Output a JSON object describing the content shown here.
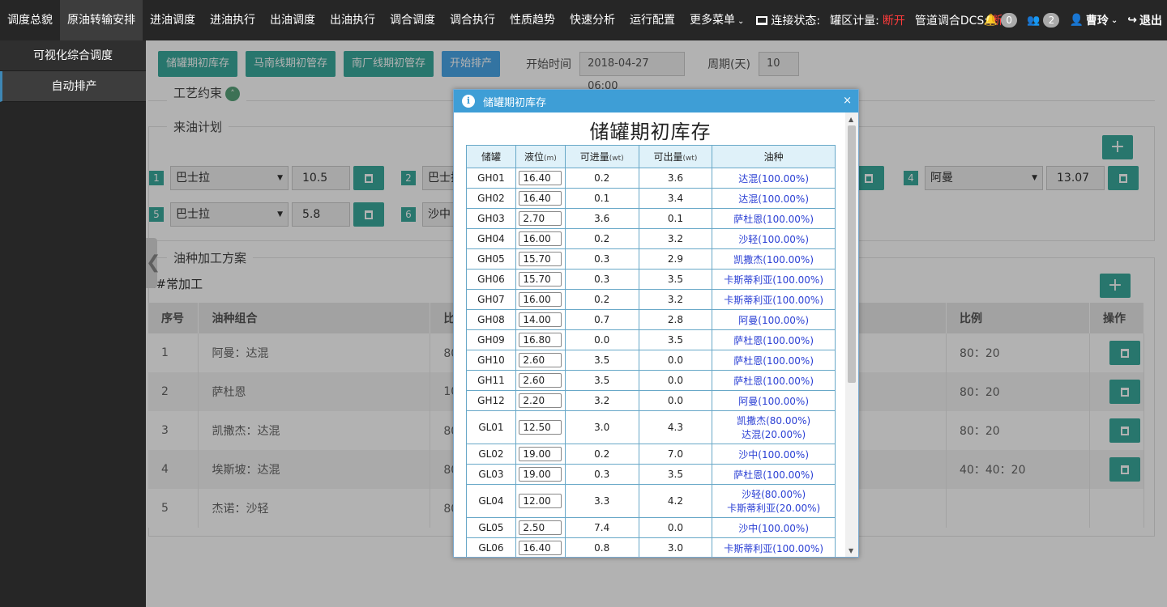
{
  "nav": {
    "items": [
      "调度总貌",
      "原油转输安排",
      "进油调度",
      "进油执行",
      "出油调度",
      "出油执行",
      "调合调度",
      "调合执行",
      "性质趋势",
      "快速分析",
      "运行配置"
    ],
    "active_index": 1,
    "more": "更多菜单",
    "connection_label": "连接状态:",
    "tank_label": "罐区计量:",
    "tank_status": "断开",
    "dcs_label": "管道调合DCS:",
    "dcs_status": "断开",
    "notifications_count": "0",
    "users_count": "2",
    "user_name": "曹玲",
    "logout": "退出",
    "status_color": "#ff3b3b"
  },
  "sidebar": {
    "items": [
      {
        "label": "可视化综合调度"
      },
      {
        "label": "自动排产"
      }
    ],
    "active_index": 1
  },
  "toolbar": {
    "btn1": "储罐期初库存",
    "btn2": "马南线期初管存",
    "btn3": "南厂线期初管存",
    "btn4": "开始排产",
    "start_label": "开始时间",
    "start_value": "2018-04-27 06:00",
    "period_label": "周期(天)",
    "period_value": "10"
  },
  "sections": {
    "constraint": "工艺约束",
    "incoming": "来油计划",
    "processing": "油种加工方案",
    "unit": "1#常加工"
  },
  "incoming_plan": [
    {
      "num": "1",
      "oil": "巴士拉",
      "value": "10.5"
    },
    {
      "num": "2",
      "oil": "巴士拉",
      "value": ""
    },
    {
      "num": "4",
      "oil": "阿曼",
      "value": "13.07"
    },
    {
      "num": "5",
      "oil": "巴士拉",
      "value": "5.8"
    },
    {
      "num": "6",
      "oil": "沙中",
      "value": ""
    }
  ],
  "bg_table": {
    "headers": [
      "序号",
      "油种组合",
      "比例",
      "比例",
      "操作"
    ],
    "rows": [
      {
        "no": "1",
        "combo": "阿曼：达混",
        "ratio": "80：",
        "ratio2": "80：20"
      },
      {
        "no": "2",
        "combo": "萨杜恩",
        "ratio": "100",
        "ratio2": "80：20"
      },
      {
        "no": "3",
        "combo": "凯撒杰：达混",
        "ratio": "80：",
        "ratio2": "80：20"
      },
      {
        "no": "4",
        "combo": "埃斯坡：达混",
        "ratio": "80：",
        "ratio2": "40：40：20"
      },
      {
        "no": "5",
        "combo": "杰诺：沙轻",
        "ratio": "80：",
        "ratio2": ""
      }
    ]
  },
  "dialog": {
    "header": "储罐期初库存",
    "close": "×",
    "title": "储罐期初库存",
    "columns": {
      "tank": "储罐",
      "level": "液位",
      "level_unit": "(m)",
      "in": "可进量",
      "in_unit": "(wt)",
      "out": "可出量",
      "out_unit": "(wt)",
      "oil": "油种"
    },
    "rows": [
      {
        "tank": "GH01",
        "level": "16.40",
        "in": "0.2",
        "out": "3.6",
        "oil": [
          "达混(100.00%)"
        ]
      },
      {
        "tank": "GH02",
        "level": "16.40",
        "in": "0.1",
        "out": "3.4",
        "oil": [
          "达混(100.00%)"
        ]
      },
      {
        "tank": "GH03",
        "level": "2.70",
        "in": "3.6",
        "out": "0.1",
        "oil": [
          "萨杜恩(100.00%)"
        ]
      },
      {
        "tank": "GH04",
        "level": "16.00",
        "in": "0.2",
        "out": "3.2",
        "oil": [
          "沙轻(100.00%)"
        ]
      },
      {
        "tank": "GH05",
        "level": "15.70",
        "in": "0.3",
        "out": "2.9",
        "oil": [
          "凯撒杰(100.00%)"
        ]
      },
      {
        "tank": "GH06",
        "level": "15.70",
        "in": "0.3",
        "out": "3.5",
        "oil": [
          "卡斯蒂利亚(100.00%)"
        ]
      },
      {
        "tank": "GH07",
        "level": "16.00",
        "in": "0.2",
        "out": "3.2",
        "oil": [
          "卡斯蒂利亚(100.00%)"
        ]
      },
      {
        "tank": "GH08",
        "level": "14.00",
        "in": "0.7",
        "out": "2.8",
        "oil": [
          "阿曼(100.00%)"
        ]
      },
      {
        "tank": "GH09",
        "level": "16.80",
        "in": "0.0",
        "out": "3.5",
        "oil": [
          "萨杜恩(100.00%)"
        ]
      },
      {
        "tank": "GH10",
        "level": "2.60",
        "in": "3.5",
        "out": "0.0",
        "oil": [
          "萨杜恩(100.00%)"
        ]
      },
      {
        "tank": "GH11",
        "level": "2.60",
        "in": "3.5",
        "out": "0.0",
        "oil": [
          "萨杜恩(100.00%)"
        ]
      },
      {
        "tank": "GH12",
        "level": "2.20",
        "in": "3.2",
        "out": "0.0",
        "oil": [
          "阿曼(100.00%)"
        ]
      },
      {
        "tank": "GL01",
        "level": "12.50",
        "in": "3.0",
        "out": "4.3",
        "oil": [
          "凯撒杰(80.00%)",
          "达混(20.00%)"
        ]
      },
      {
        "tank": "GL02",
        "level": "19.00",
        "in": "0.2",
        "out": "7.0",
        "oil": [
          "沙中(100.00%)"
        ]
      },
      {
        "tank": "GL03",
        "level": "19.00",
        "in": "0.3",
        "out": "3.5",
        "oil": [
          "萨杜恩(100.00%)"
        ]
      },
      {
        "tank": "GL04",
        "level": "12.00",
        "in": "3.3",
        "out": "4.2",
        "oil": [
          "沙轻(80.00%)",
          "卡斯蒂利亚(20.00%)"
        ]
      },
      {
        "tank": "GL05",
        "level": "2.50",
        "in": "7.4",
        "out": "0.0",
        "oil": [
          "沙中(100.00%)"
        ]
      },
      {
        "tank": "GL06",
        "level": "16.40",
        "in": "0.8",
        "out": "3.0",
        "oil": [
          "卡斯蒂利亚(100.00%)"
        ]
      }
    ]
  },
  "icons": {
    "bell": "bell-icon",
    "users": "users-icon",
    "user": "user-icon",
    "logout": "logout-icon",
    "monitor": "monitor-icon",
    "trash": "trash-icon",
    "plus": "plus-icon",
    "info": "info-icon"
  }
}
